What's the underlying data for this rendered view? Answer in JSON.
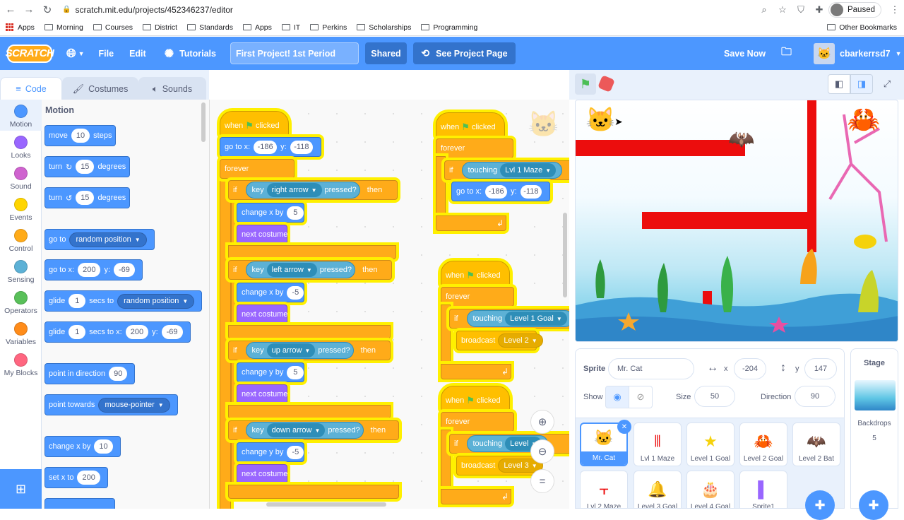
{
  "browser": {
    "url": "scratch.mit.edu/projects/452346237/editor",
    "paused_label": "Paused",
    "bookmarks": [
      "Apps",
      "Morning",
      "Courses",
      "District",
      "Standards",
      "Apps",
      "IT",
      "Perkins",
      "Scholarships",
      "Programming"
    ],
    "other_bookmarks": "Other Bookmarks"
  },
  "menubar": {
    "logo": "SCRATCH",
    "file": "File",
    "edit": "Edit",
    "tutorials": "Tutorials",
    "project_title": "First Project! 1st Period",
    "shared": "Shared",
    "see_project": "See Project Page",
    "save_now": "Save Now",
    "username": "cbarkerrsd7"
  },
  "tabs": {
    "code": "Code",
    "costumes": "Costumes",
    "sounds": "Sounds"
  },
  "categories": [
    {
      "label": "Motion",
      "color": "#4c97ff"
    },
    {
      "label": "Looks",
      "color": "#9966ff"
    },
    {
      "label": "Sound",
      "color": "#cf63cf"
    },
    {
      "label": "Events",
      "color": "#ffd500"
    },
    {
      "label": "Control",
      "color": "#ffab19"
    },
    {
      "label": "Sensing",
      "color": "#5cb1d6"
    },
    {
      "label": "Operators",
      "color": "#59c059"
    },
    {
      "label": "Variables",
      "color": "#ff8c1a"
    },
    {
      "label": "My Blocks",
      "color": "#ff6680"
    }
  ],
  "palette": {
    "title": "Motion",
    "move": "move",
    "move_val": "10",
    "steps": "steps",
    "turn": "turn",
    "turn_val": "15",
    "degrees": "degrees",
    "goto": "go to",
    "random_position": "random position",
    "goto_xy": "go to x:",
    "x_val": "200",
    "y_label": "y:",
    "y_val": "-69",
    "glide": "glide",
    "glide_val": "1",
    "secs_to": "secs to",
    "secs_to_x": "secs to x:",
    "point_dir": "point in direction",
    "dir_val": "90",
    "point_towards": "point towards",
    "mouse_pointer": "mouse-pointer",
    "change_x": "change x by",
    "change_x_val": "10",
    "set_x": "set x to",
    "set_x_val": "200"
  },
  "scripts": {
    "when": "when",
    "clicked": "clicked",
    "goto_xy": "go to x:",
    "x1": "-186",
    "y_label": "y:",
    "y1": "-118",
    "forever": "forever",
    "if": "if",
    "then": "then",
    "key": "key",
    "pressed": "pressed?",
    "right_arrow": "right arrow",
    "left_arrow": "left arrow",
    "up_arrow": "up arrow",
    "down_arrow": "down arrow",
    "change_x": "change x by",
    "change_y": "change y by",
    "v5": "5",
    "vm5": "-5",
    "next_costume": "next costume",
    "touching": "touching",
    "lvl1maze": "Lvl 1 Maze",
    "level1goal": "Level 1 Goal",
    "level_goal_cut": "Level",
    "broadcast": "broadcast",
    "level2": "Level 2",
    "level3": "Level 3"
  },
  "sprite_info": {
    "sprite_label": "Sprite",
    "sprite_name": "Mr. Cat",
    "x_label": "x",
    "x_val": "-204",
    "y_label": "y",
    "y_val": "147",
    "show_label": "Show",
    "size_label": "Size",
    "size_val": "50",
    "direction_label": "Direction",
    "direction_val": "90"
  },
  "sprites": [
    "Mr. Cat",
    "Lvl 1 Maze",
    "Level 1 Goal",
    "Level 2 Goal",
    "Level 2 Bat",
    "Lvl 2 Maze",
    "Level 3 Goal",
    "Level 4 Goal",
    "Sprite1"
  ],
  "stage_pane": {
    "title": "Stage",
    "backdrops_label": "Backdrops",
    "backdrops_count": "5"
  }
}
